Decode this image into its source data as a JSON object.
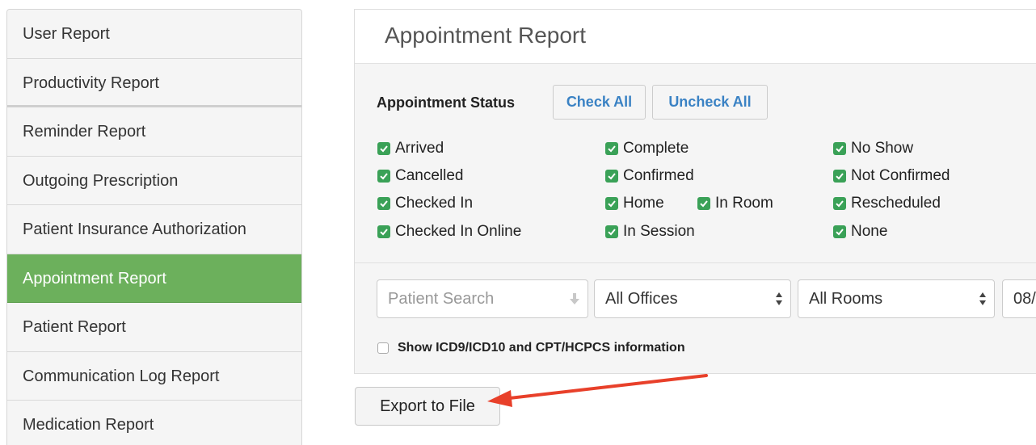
{
  "sidebar": {
    "items": [
      {
        "label": "User Report"
      },
      {
        "label": "Productivity Report"
      },
      {
        "label": "Reminder Report"
      },
      {
        "label": "Outgoing Prescription"
      },
      {
        "label": "Patient Insurance Authorization"
      },
      {
        "label": "Appointment Report"
      },
      {
        "label": "Patient Report"
      },
      {
        "label": "Communication Log Report"
      },
      {
        "label": "Medication Report"
      }
    ],
    "active_index": 5
  },
  "panel": {
    "title": "Appointment Report",
    "status_label": "Appointment Status",
    "check_all_label": "Check All",
    "uncheck_all_label": "Uncheck All",
    "statuses": [
      {
        "label": "Arrived",
        "checked": true
      },
      {
        "label": "Cancelled",
        "checked": true
      },
      {
        "label": "Checked In",
        "checked": true
      },
      {
        "label": "Checked In Online",
        "checked": true
      },
      {
        "label": "Complete",
        "checked": true
      },
      {
        "label": "Confirmed",
        "checked": true
      },
      {
        "label": "Home",
        "checked": true
      },
      {
        "label": "In Room",
        "checked": true
      },
      {
        "label": "In Session",
        "checked": true
      },
      {
        "label": "No Show",
        "checked": true
      },
      {
        "label": "Not Confirmed",
        "checked": true
      },
      {
        "label": "Rescheduled",
        "checked": true
      },
      {
        "label": "None",
        "checked": true
      }
    ],
    "filters": {
      "patient_search_placeholder": "Patient Search",
      "office_value": "All Offices",
      "room_value": "All Rooms",
      "date_partial": "08/"
    },
    "show_codes_label": "Show ICD9/ICD10 and CPT/HCPCS information",
    "show_codes_checked": false
  },
  "export_button_label": "Export to File",
  "colors": {
    "active_green": "#6cb05c",
    "checkbox_green": "#3aa157",
    "link_blue": "#3a82c4",
    "annotation_red": "#e8402a"
  }
}
